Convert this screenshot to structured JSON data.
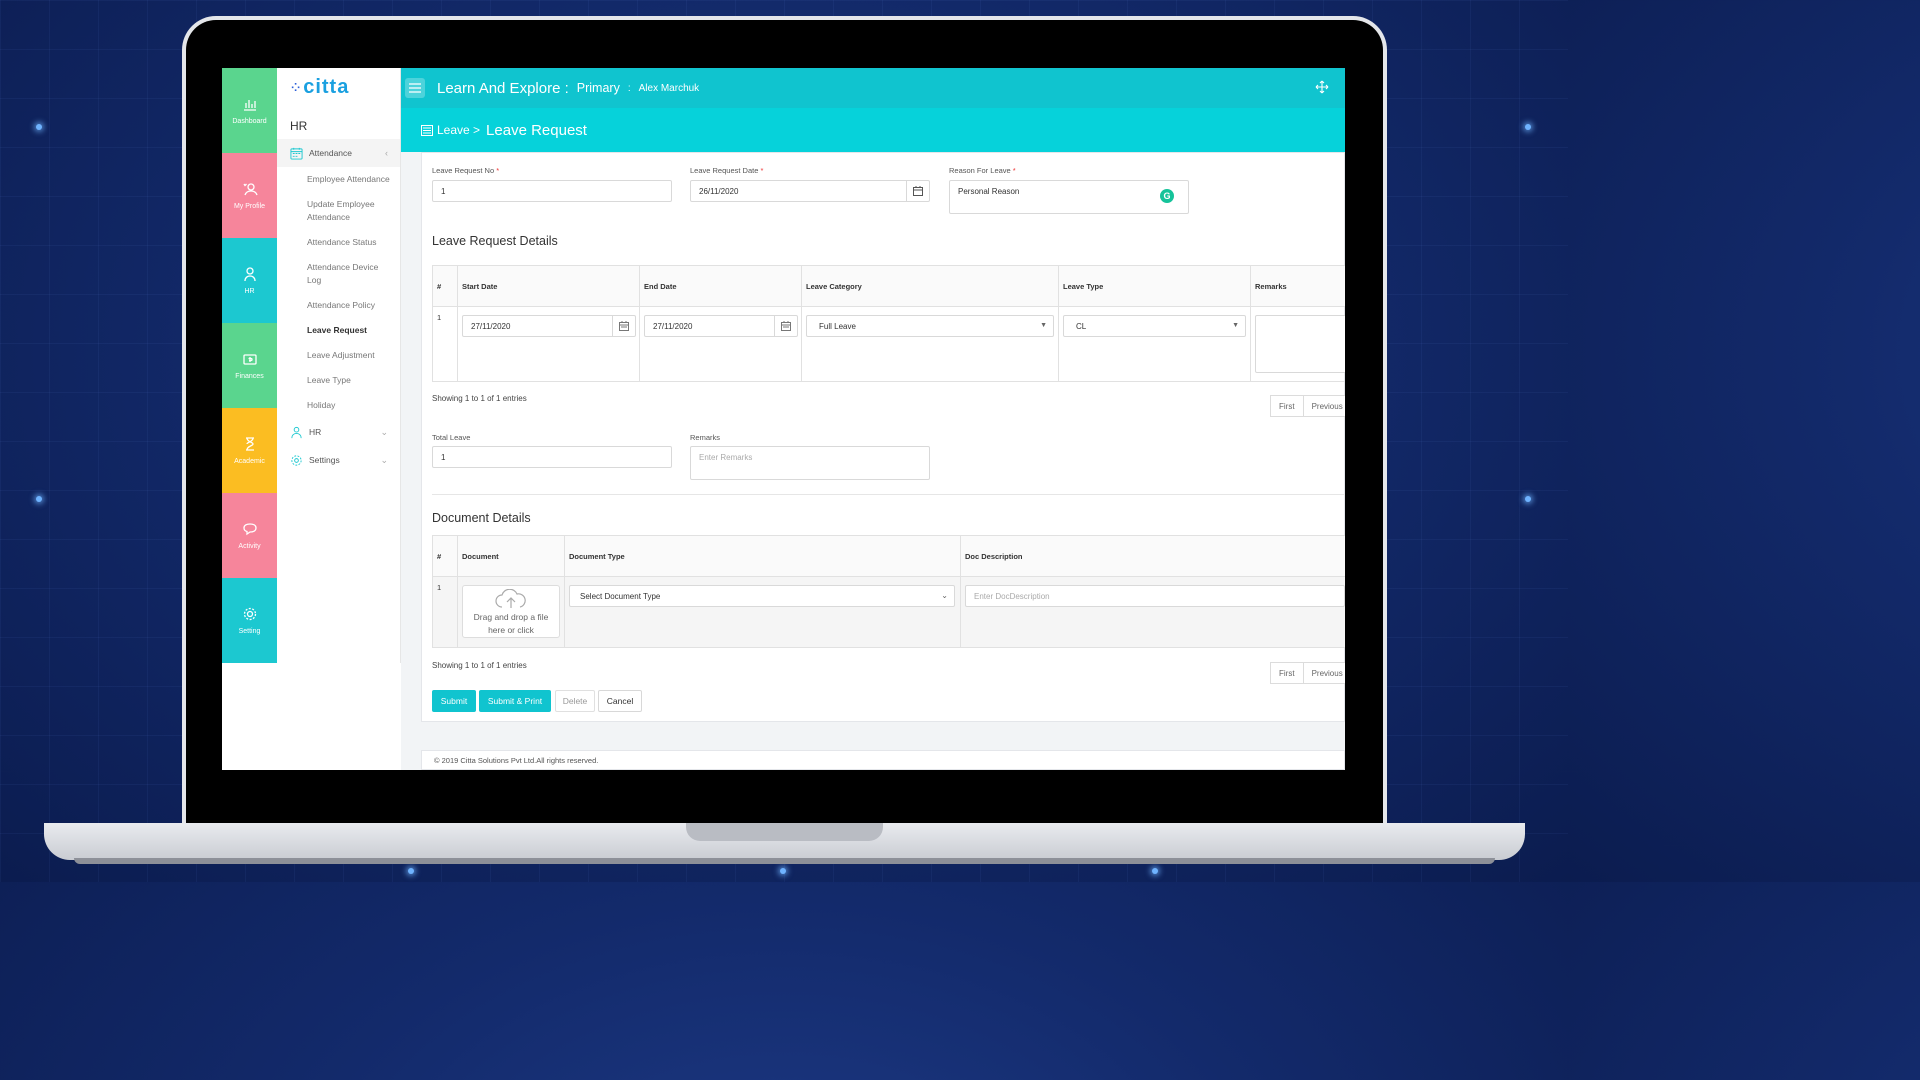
{
  "rail": {
    "dashboard": "Dashboard",
    "profile": "My Profile",
    "hr": "HR",
    "finances": "Finances",
    "academic": "Academic",
    "activity": "Activity",
    "setting": "Setting"
  },
  "sidebar": {
    "logo": "citta",
    "title": "HR",
    "attendance": "Attendance",
    "items": [
      "Employee Attendance",
      "Update Employee Attendance",
      "Attendance Status",
      "Attendance Device Log",
      "Attendance Policy",
      "Leave Request",
      "Leave Adjustment",
      "Leave Type",
      "Holiday"
    ],
    "hr_group": "HR",
    "settings_group": "Settings"
  },
  "topbar": {
    "app_title": "Learn And Explore :",
    "branch": "Primary",
    "separator": ":",
    "user": "Alex Marchuk"
  },
  "breadcrumb": {
    "parent": "Leave >",
    "page": "Leave Request"
  },
  "form": {
    "request_no_label": "Leave Request No",
    "request_no_value": "1",
    "request_date_label": "Leave Request Date",
    "request_date_value": "26/11/2020",
    "reason_label": "Reason For Leave",
    "reason_value": "Personal Reason",
    "required_mark": "*"
  },
  "leave_details": {
    "title": "Leave Request Details",
    "columns": [
      "#",
      "Start Date",
      "End Date",
      "Leave Category",
      "Leave Type",
      "Remarks"
    ],
    "rows": [
      {
        "index": "1",
        "start": "27/11/2020",
        "end": "27/11/2020",
        "category": "Full Leave",
        "type": "CL"
      }
    ],
    "showing": "Showing 1 to 1 of 1 entries",
    "pager_first": "First",
    "pager_previous": "Previous"
  },
  "totals": {
    "total_label": "Total Leave",
    "total_value": "1",
    "remarks_label": "Remarks",
    "remarks_placeholder": "Enter Remarks"
  },
  "documents": {
    "title": "Document Details",
    "columns": [
      "#",
      "Document",
      "Document Type",
      "Doc Description"
    ],
    "rows": [
      {
        "index": "1",
        "upload_text": "Drag and drop a file here or click",
        "type_placeholder": "Select Document Type",
        "desc_placeholder": "Enter DocDescription"
      }
    ],
    "showing": "Showing 1 to 1 of 1 entries",
    "pager_first": "First",
    "pager_previous": "Previous"
  },
  "actions": {
    "submit": "Submit",
    "submit_print": "Submit & Print",
    "delete": "Delete",
    "cancel": "Cancel"
  },
  "footer": {
    "copyright": "© 2019 Citta Solutions Pvt Ltd.All rights reserved."
  },
  "colors": {
    "primary": "#10c4cf",
    "rail_green": "#5ad58e",
    "rail_pink": "#f6859b",
    "rail_teal": "#1cc8d0",
    "rail_yellow": "#fbbd22"
  }
}
